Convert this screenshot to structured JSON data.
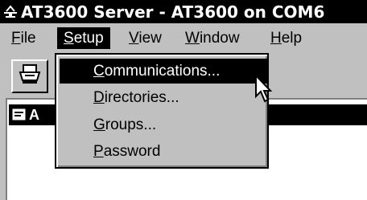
{
  "window": {
    "title": "AT3600 Server - AT3600 on COM6",
    "title_icon": "network-server-icon"
  },
  "menubar": {
    "items": [
      {
        "pre": "",
        "key": "F",
        "post": "ile"
      },
      {
        "pre": "",
        "key": "S",
        "post": "etup"
      },
      {
        "pre": "",
        "key": "V",
        "post": "iew"
      },
      {
        "pre": "",
        "key": "W",
        "post": "indow"
      },
      {
        "pre": "",
        "key": "H",
        "post": "elp"
      }
    ]
  },
  "toolbar": {
    "print_icon": "printer-icon"
  },
  "child_window": {
    "title": "A",
    "icon": "document-icon"
  },
  "setup_menu": {
    "items": [
      {
        "pre": "",
        "key": "C",
        "post": "ommunications..."
      },
      {
        "pre": "",
        "key": "D",
        "post": "irectories..."
      },
      {
        "pre": "",
        "key": "G",
        "post": "roups..."
      },
      {
        "pre": "",
        "key": "P",
        "post": "assword"
      }
    ],
    "selected_index": 0
  },
  "colors": {
    "selection": "#000000",
    "face": "#c0c0c0",
    "workspace": "#ffffff"
  }
}
